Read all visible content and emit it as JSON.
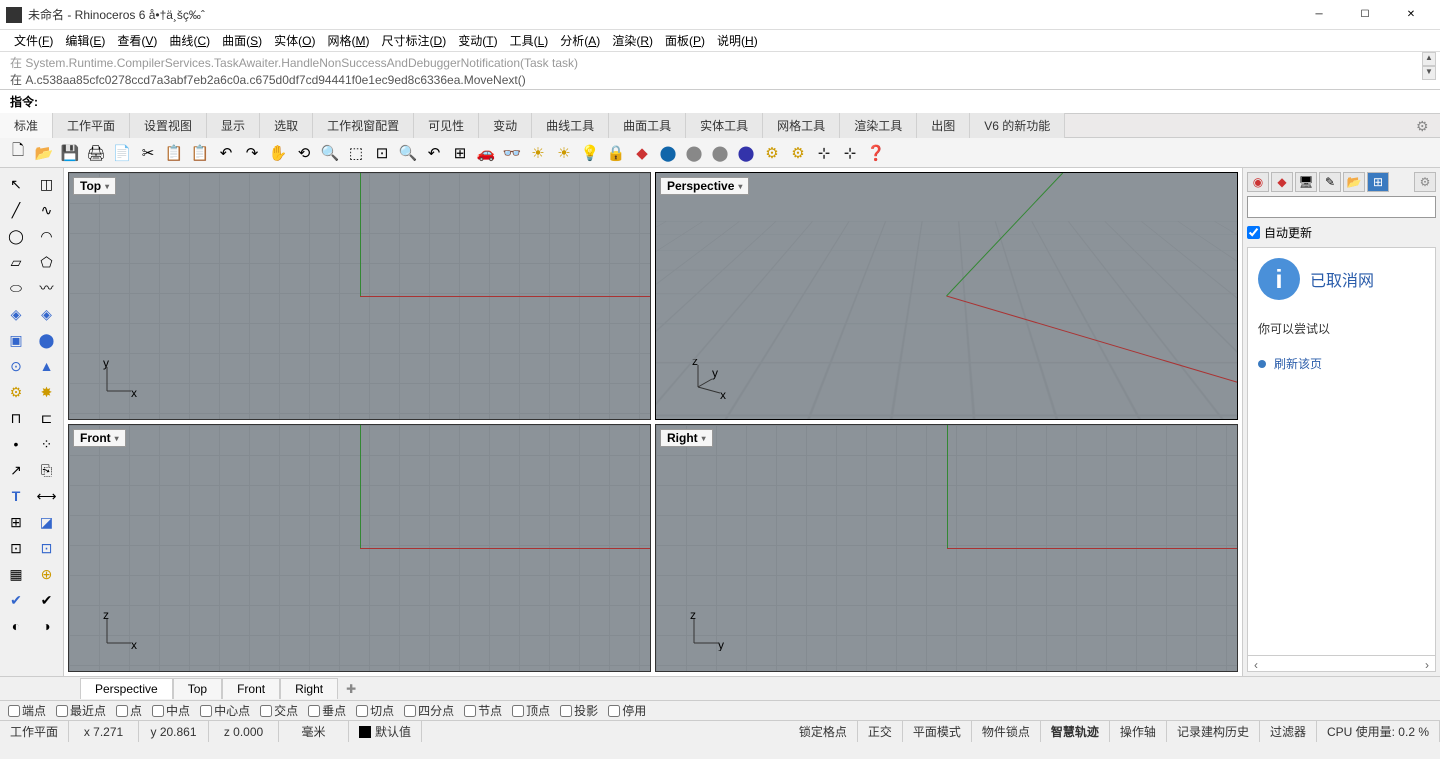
{
  "titlebar": {
    "title": "未命名 - Rhinoceros 6 å•†ä¸šç‰ˆ"
  },
  "menubar": [
    {
      "label": "文件",
      "key": "F"
    },
    {
      "label": "编辑",
      "key": "E"
    },
    {
      "label": "查看",
      "key": "V"
    },
    {
      "label": "曲线",
      "key": "C"
    },
    {
      "label": "曲面",
      "key": "S"
    },
    {
      "label": "实体",
      "key": "O"
    },
    {
      "label": "网格",
      "key": "M"
    },
    {
      "label": "尺寸标注",
      "key": "D"
    },
    {
      "label": "变动",
      "key": "T"
    },
    {
      "label": "工具",
      "key": "L"
    },
    {
      "label": "分析",
      "key": "A"
    },
    {
      "label": "渲染",
      "key": "R"
    },
    {
      "label": "面板",
      "key": "P"
    },
    {
      "label": "说明",
      "key": "H"
    }
  ],
  "command_history": {
    "line1": "在 System.Runtime.CompilerServices.TaskAwaiter.HandleNonSuccessAndDebuggerNotification(Task task)",
    "line2": "在 A.c538aa85cfc0278ccd7a3abf7eb2a6c0a.c675d0df7cd94441f0e1ec9ed8c6336ea.MoveNext()"
  },
  "command_prompt": "指令:",
  "toolbar_tabs": [
    "标准",
    "工作平面",
    "设置视图",
    "显示",
    "选取",
    "工作视窗配置",
    "可见性",
    "变动",
    "曲线工具",
    "曲面工具",
    "实体工具",
    "网格工具",
    "渲染工具",
    "出图",
    "V6 的新功能"
  ],
  "viewports": {
    "top": "Top",
    "perspective": "Perspective",
    "front": "Front",
    "right": "Right",
    "axis_top": {
      "a": "y",
      "b": "x"
    },
    "axis_persp": {
      "a": "z",
      "b": "y",
      "c": "x"
    },
    "axis_front": {
      "a": "z",
      "b": "x"
    },
    "axis_right": {
      "a": "z",
      "b": "y"
    }
  },
  "right_panel": {
    "auto_update": "自动更新",
    "info_title": "已取消网",
    "info_text": "你可以尝试以",
    "info_link": "刷新该页"
  },
  "vp_tabs": [
    "Perspective",
    "Top",
    "Front",
    "Right"
  ],
  "osnaps": [
    "端点",
    "最近点",
    "点",
    "中点",
    "中心点",
    "交点",
    "垂点",
    "切点",
    "四分点",
    "节点",
    "顶点",
    "投影",
    "停用"
  ],
  "status": {
    "cplane": "工作平面",
    "x": "x 7.271",
    "y": "y 20.861",
    "z": "z 0.000",
    "unit": "毫米",
    "layer": "默认值",
    "gridsnap": "锁定格点",
    "ortho": "正交",
    "planar": "平面模式",
    "osnap": "物件锁点",
    "smart": "智慧轨迹",
    "gumball": "操作轴",
    "history": "记录建构历史",
    "filter": "过滤器",
    "cpu": "CPU 使用量: 0.2 %"
  }
}
